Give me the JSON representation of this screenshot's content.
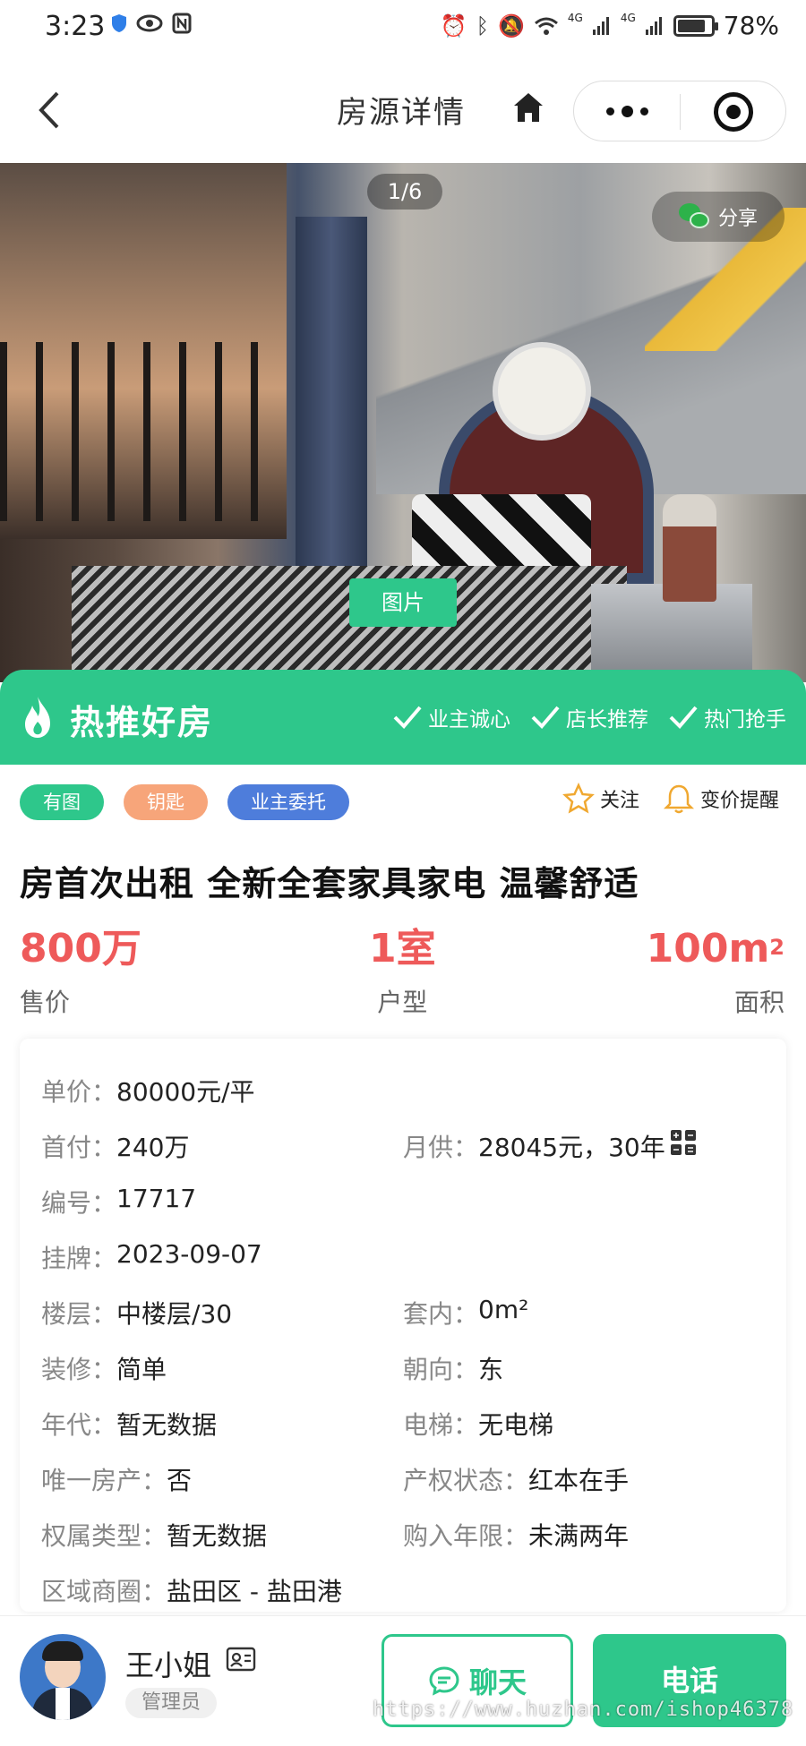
{
  "status_bar": {
    "time": "3:23",
    "battery": "78%",
    "network_1": "4G",
    "network_2": "4G"
  },
  "nav": {
    "title": "房源详情",
    "icons": [
      "back-icon",
      "home-icon",
      "more-icon",
      "close-target-icon"
    ]
  },
  "gallery": {
    "counter": "1/6",
    "share_label": "分享",
    "tab_label": "图片"
  },
  "banner": {
    "title": "热推好房",
    "tags": [
      "业主诚心",
      "店长推荐",
      "热门抢手"
    ]
  },
  "tags": [
    "有图",
    "钥匙",
    "业主委托"
  ],
  "actions": {
    "follow": "关注",
    "price_alert": "变价提醒"
  },
  "listing": {
    "title": "房首次出租 全新全套家具家电 温馨舒适"
  },
  "stats": {
    "price_value": "800万",
    "price_label": "售价",
    "layout_value": "1室",
    "layout_label": "户型",
    "area_value": "100m",
    "area_sup": "2",
    "area_label": "面积"
  },
  "details": {
    "unit_price_label": "单价：",
    "unit_price": "80000元/平",
    "down_payment_label": "首付：",
    "down_payment": "240万",
    "monthly_label": "月供：",
    "monthly": "28045元，30年",
    "code_label": "编号：",
    "code": "17717",
    "listed_label": "挂牌：",
    "listed": "2023-09-07",
    "floor_label": "楼层：",
    "floor": "中楼层/30",
    "inner_label": "套内：",
    "inner": "0m²",
    "decoration_label": "装修：",
    "decoration": "简单",
    "orientation_label": "朝向：",
    "orientation": "东",
    "year_label": "年代：",
    "year": "暂无数据",
    "elevator_label": "电梯：",
    "elevator": "无电梯",
    "only_house_label": "唯一房产：",
    "only_house": "否",
    "property_status_label": "产权状态：",
    "property_status": "红本在手",
    "ownership_label": "权属类型：",
    "ownership": "暂无数据",
    "purchase_years_label": "购入年限：",
    "purchase_years": "未满两年",
    "district_label": "区域商圈：",
    "district": "盐田区 - 盐田港"
  },
  "agent": {
    "name": "王小姐",
    "role": "管理员",
    "chat_label": "聊天",
    "call_label": "电话"
  },
  "watermark": "https://www.huzhan.com/ishop46378",
  "colors": {
    "accent": "#2ec78b",
    "price": "#ee5a5a",
    "tag_orange": "#f7a57a",
    "tag_blue": "#4e7ddb"
  }
}
